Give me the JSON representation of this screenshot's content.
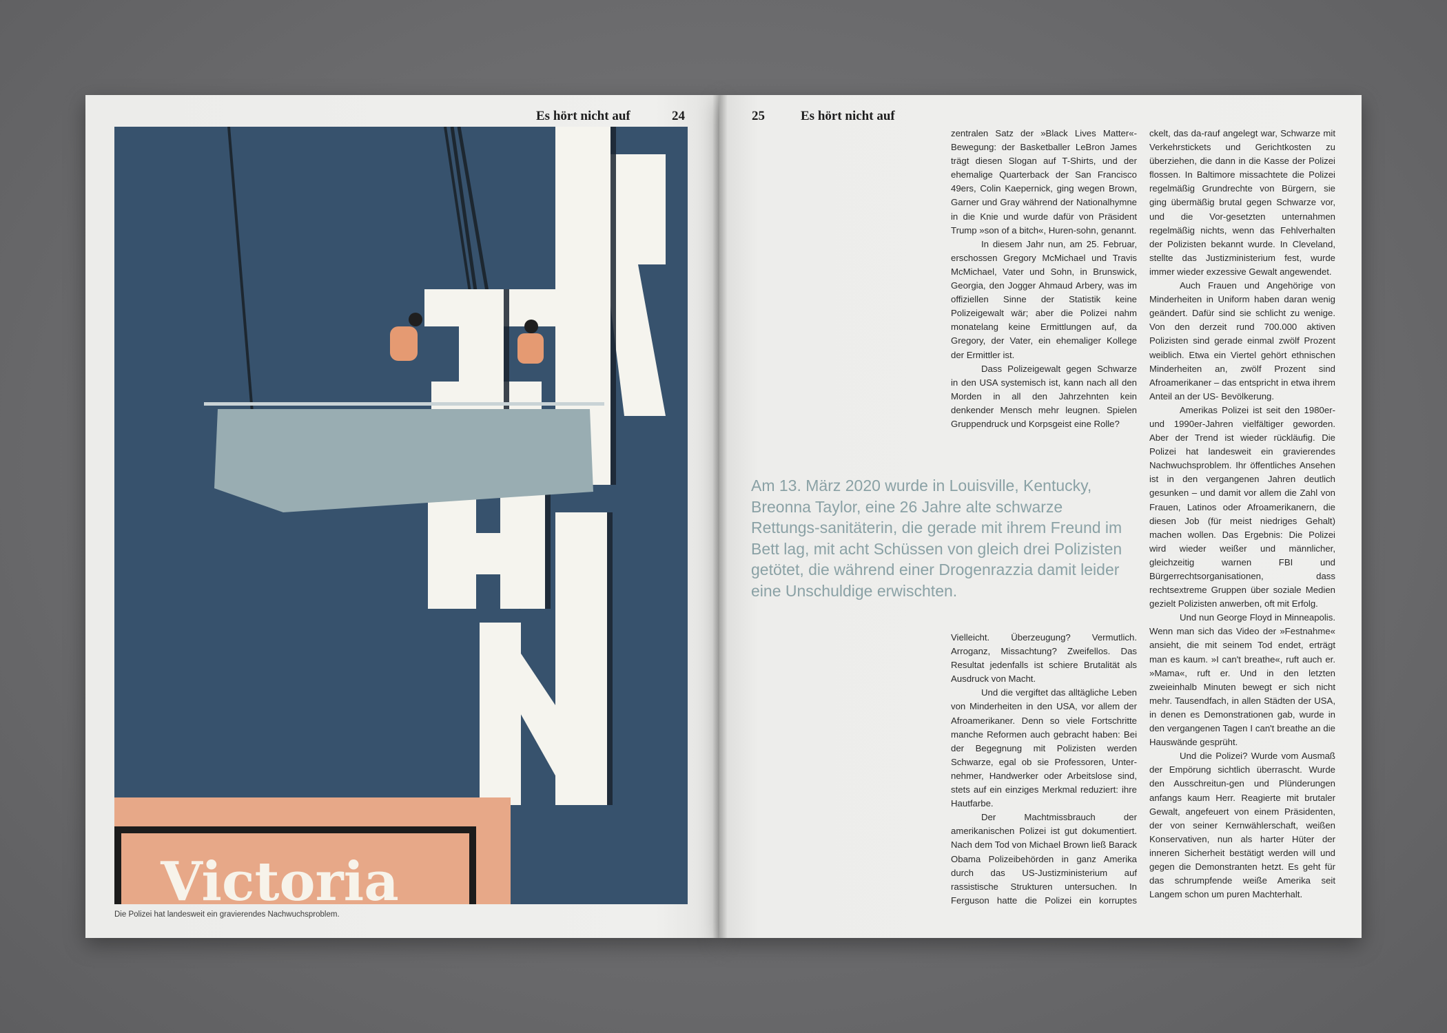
{
  "left_page": {
    "running_title": "Es hört nicht auf",
    "page_number": "24",
    "caption": "Die Polizei hat landesweit ein gravierendes Nachwuchsproblem.",
    "illustration": {
      "sign_text": "Victoria",
      "colors": {
        "navy": "#3a5570",
        "salmon": "#e7a888",
        "banner": "#99adb2",
        "letters": "#f5f4ee"
      }
    }
  },
  "right_page": {
    "page_number": "25",
    "running_title": "Es hört nicht auf",
    "col1_top": [
      "zentralen Satz der »Black Lives Matter«-Bewegung: der Basketballer LeBron James trägt diesen Slogan auf T-Shirts, und der ehemalige Quarterback der San Francisco 49ers, Colin Kaepernick, ging wegen Brown, Garner und Gray während der Nationalhymne in die Knie und wurde dafür von Präsident Trump »son of a bitch«, Huren-sohn, genannt.",
      "In diesem Jahr nun, am 25. Februar, erschossen Gregory McMichael und Travis McMichael, Vater und Sohn, in Brunswick, Georgia, den Jogger Ahmaud Arbery, was im offiziellen Sinne der Statistik keine Polizeigewalt wär; aber die Polizei nahm monatelang keine Ermittlungen auf, da Gregory, der Vater, ein ehemaliger Kollege der Ermittler ist.",
      "Dass Polizeigewalt gegen Schwarze in den USA systemisch ist, kann nach all den Morden in all den Jahrzehnten kein denkender Mensch mehr leugnen. Spielen Gruppendruck und Korpsgeist eine Rolle?"
    ],
    "pull_quote": "Am 13. März 2020 wurde in Louisville, Kentucky, Breonna Taylor, eine 26 Jahre alte schwarze Rettungs-sanitäterin, die gerade mit ihrem Freund im Bett lag, mit acht Schüssen von gleich drei Polizisten getötet, die während einer Drogenrazzia damit leider eine Unschuldige erwischten.",
    "col1_bottom": [
      "Vielleicht. Überzeugung? Vermutlich. Arroganz, Missachtung? Zweifellos. Das Resultat jedenfalls ist schiere Brutalität als Ausdruck von Macht.",
      "Und die vergiftet das alltägliche Leben von Minderheiten in den USA, vor allem der Afroamerikaner. Denn so viele Fortschritte manche Reformen auch gebracht haben: Bei der Begegnung mit Polizisten werden Schwarze, egal ob sie Professoren, Unter-nehmer, Handwerker oder Arbeitslose sind, stets auf ein einziges Merkmal reduziert: ihre Hautfarbe.",
      "Der Machtmissbrauch der amerikanischen Polizei ist gut dokumentiert. Nach dem Tod von Michael Brown ließ Barack Obama Polizeibehörden in ganz Amerika durch das US-Justizministerium auf rassistische Strukturen untersuchen. In Ferguson hatte die Polizei ein korruptes System entwi-"
    ],
    "col2": [
      "ckelt, das da-rauf angelegt war, Schwarze mit Verkehrstickets und Gerichtkosten zu überziehen, die dann in die Kasse der Polizei flossen. In Baltimore missachtete die Polizei regelmäßig Grundrechte von Bürgern, sie ging übermäßig brutal gegen Schwarze vor, und die Vor-gesetzten unternahmen regelmäßig nichts, wenn das Fehlverhalten der Polizisten bekannt wurde. In Cleveland, stellte das Justizministerium fest, wurde immer wieder exzessive Gewalt angewendet.",
      "Auch Frauen und Angehörige von Minderheiten in Uniform haben daran wenig geändert. Dafür sind sie schlicht zu wenige. Von den derzeit rund 700.000 aktiven Polizisten sind gerade einmal zwölf Prozent weiblich. Etwa ein Viertel gehört ethnischen Minderheiten an, zwölf Prozent sind Afroamerikaner – das entspricht in etwa ihrem Anteil an der US- Bevölkerung.",
      "Amerikas Polizei ist seit den 1980er- und 1990er-Jahren vielfältiger geworden. Aber der Trend ist wieder rückläufig. Die Polizei hat landesweit ein gravierendes Nachwuchsproblem. Ihr öffentliches Ansehen ist in den vergangenen Jahren deutlich gesunken – und damit vor allem die Zahl von Frauen, Latinos oder Afroamerikanern, die diesen Job (für meist niedriges Gehalt) machen wollen. Das Ergebnis: Die Polizei wird wieder weißer und männlicher, gleichzeitig warnen FBI und Bürgerrechtsorganisationen, dass rechtsextreme Gruppen über soziale Medien gezielt Polizisten anwerben, oft mit Erfolg.",
      "Und nun George Floyd in Minneapolis. Wenn man sich das Video der »Festnahme« ansieht, die mit seinem Tod endet, erträgt man es kaum. »I can't breathe«, ruft auch er. »Mama«, ruft er. Und in den letzten zweieinhalb Minuten bewegt er sich nicht mehr. Tausendfach, in allen Städten der USA, in denen es Demonstrationen gab, wurde in den vergangenen Tagen I can't breathe an die Hauswände gesprüht.",
      "Und die Polizei? Wurde vom Ausmaß der Empörung sichtlich überrascht. Wurde den Ausschreitun-gen und Plünderungen anfangs kaum Herr. Reagierte mit brutaler Gewalt, angefeuert von einem Präsidenten, der von seiner Kernwählerschaft, weißen Konservativen, nun als harter Hüter der inneren Sicherheit bestätigt werden will und gegen die Demonstranten hetzt. Es geht für das schrumpfende weiße Amerika seit Langem schon um puren Machterhalt."
    ]
  }
}
